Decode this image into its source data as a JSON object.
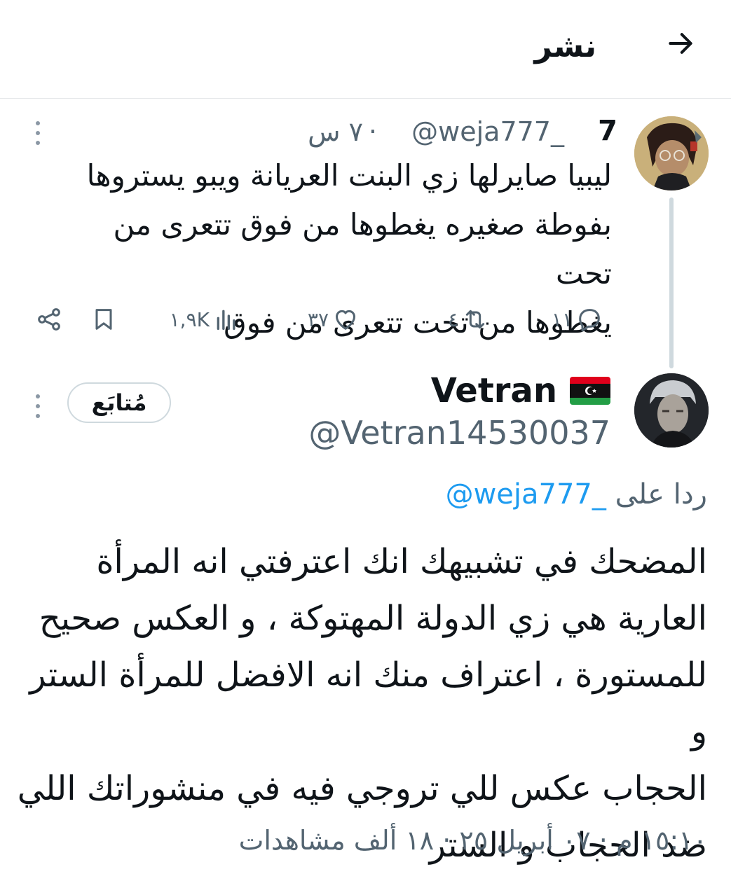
{
  "header": {
    "title": "نشر"
  },
  "parent_tweet": {
    "name": "7",
    "handle": "@weja777_",
    "separator": "·",
    "time": "٧ س",
    "text_lines": [
      "ليبيا صايرلها زي البنت العريانة ويبو يستروها",
      "بفوطة صغيره يغطوها من فوق تتعرى من تحت",
      "يغطوها من تحت تتعرى من فوق"
    ],
    "replies": "١١",
    "retweets": "٤",
    "likes": "٣٧",
    "views": "١,٩K"
  },
  "reply_tweet": {
    "name": "Vetran",
    "flag_icon": "libya-flag-icon",
    "handle": "@Vetran14530037",
    "follow_label": "مُتابَع",
    "replying_prefix": "ردا على",
    "replying_to": "@weja777_",
    "text_lines": [
      "المضحك في تشبيهك انك اعترفتي انه المرأة",
      "العارية هي زي الدولة المهتوكة ، و العكس صحيح",
      "للمستورة ، اعتراف منك انه الافضل للمرأة الستر و",
      "الحجاب عكس للي تروجي فيه في منشوراتك اللي",
      "ضد الحجاب و الستر"
    ],
    "cutoff_meta": "١٥:١٠ م · ٠٧ أبريل ٢٥ · ١٨ ألف مشاهدات"
  }
}
